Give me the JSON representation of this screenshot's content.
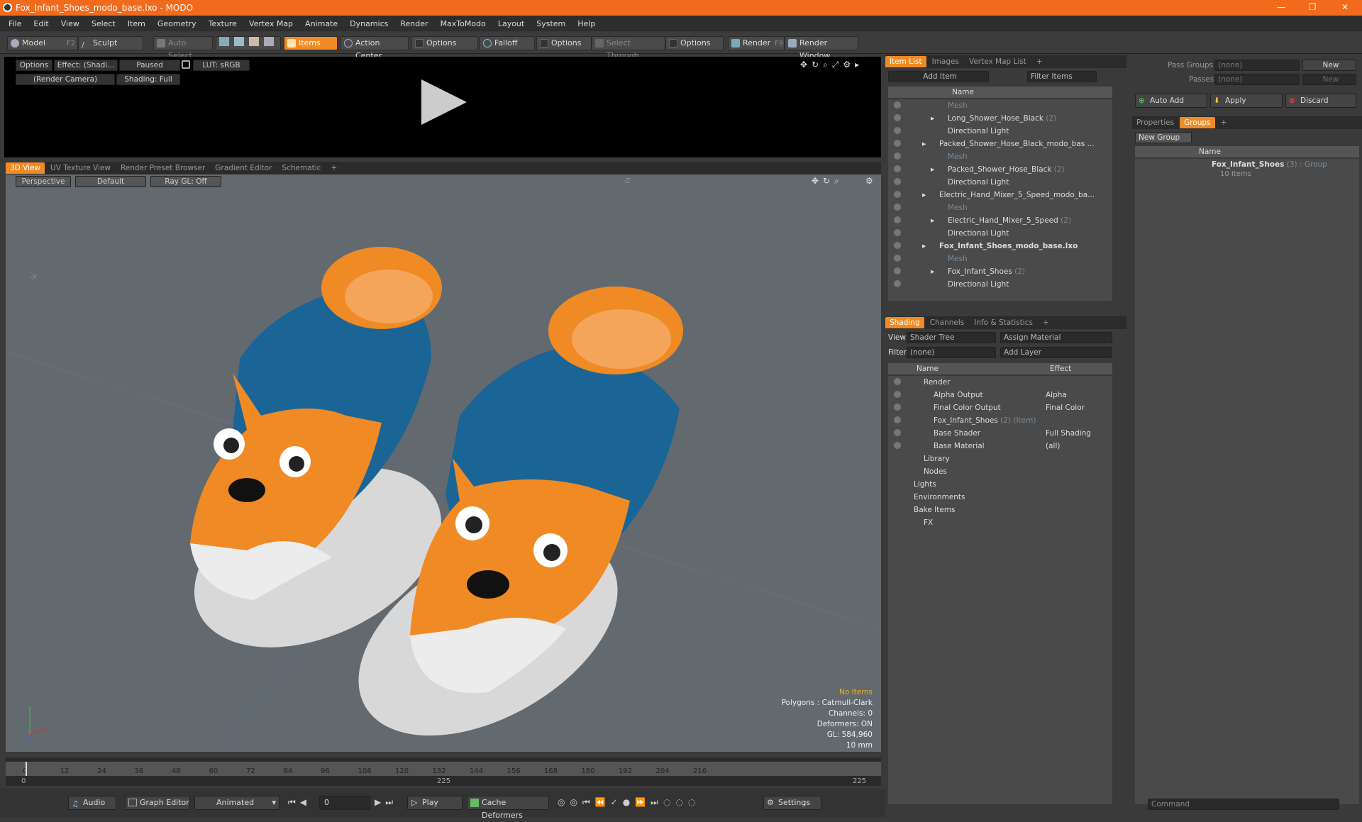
{
  "window": {
    "title": "Fox_Infant_Shoes_modo_base.lxo - MODO"
  },
  "menu": [
    "File",
    "Edit",
    "View",
    "Select",
    "Item",
    "Geometry",
    "Texture",
    "Vertex Map",
    "Animate",
    "Dynamics",
    "Render",
    "MaxToModo",
    "Layout",
    "System",
    "Help"
  ],
  "toolbar": {
    "model": "Model",
    "model_key": "F2",
    "sculpt": "Sculpt",
    "auto_select": "Auto Select",
    "items": "Items",
    "action_center": "Action Center",
    "options1": "Options",
    "falloff": "Falloff",
    "options2": "Options",
    "select_through": "Select Through",
    "options3": "Options",
    "render": "Render",
    "render_key": "F9",
    "render_window": "Render Window"
  },
  "preview": {
    "options": "Options",
    "effect": "Effect: (Shadi...",
    "paused": "Paused",
    "lut": "LUT: sRGB",
    "camera": "(Render Camera)",
    "shading": "Shading: Full"
  },
  "viewtabs": [
    "3D View",
    "UV Texture View",
    "Render Preset Browser",
    "Gradient Editor",
    "Schematic"
  ],
  "viewport": {
    "perspective": "Perspective",
    "default": "Default",
    "raygl": "Ray GL: Off",
    "axis_z": "-Z",
    "axis_x": "-X",
    "info": {
      "items": "No Items",
      "polygons": "Polygons : Catmull-Clark",
      "channels": "Channels: 0",
      "deformers": "Deformers: ON",
      "gl": "GL: 584,960",
      "unit": "10 mm"
    }
  },
  "timeline": {
    "ticks": [
      "0",
      "12",
      "24",
      "36",
      "48",
      "60",
      "72",
      "84",
      "96",
      "108",
      "120",
      "132",
      "144",
      "156",
      "168",
      "180",
      "192",
      "204",
      "216"
    ],
    "start": "0",
    "mid": "225",
    "end": "225"
  },
  "bottom": {
    "audio": "Audio",
    "graph": "Graph Editor",
    "animated": "Animated",
    "frame": "0",
    "play": "Play",
    "cache": "Cache Deformers",
    "settings": "Settings",
    "command": "Command"
  },
  "itemlist": {
    "tabs": [
      "Item List",
      "Images",
      "Vertex Map List"
    ],
    "add_item": "Add Item",
    "filter": "Filter Items",
    "col_name": "Name",
    "rows": [
      {
        "label": "Mesh",
        "dim": true,
        "indent": 2
      },
      {
        "label": "Long_Shower_Hose_Black",
        "count": "(2)",
        "indent": 2,
        "arrow": true
      },
      {
        "label": "Directional Light",
        "indent": 2
      },
      {
        "label": "Packed_Shower_Hose_Black_modo_bas ...",
        "indent": 1,
        "arrow": true
      },
      {
        "label": "Mesh",
        "dim": true,
        "indent": 2
      },
      {
        "label": "Packed_Shower_Hose_Black",
        "count": "(2)",
        "indent": 2,
        "arrow": true
      },
      {
        "label": "Directional Light",
        "indent": 2
      },
      {
        "label": "Electric_Hand_Mixer_5_Speed_modo_ba...",
        "indent": 1,
        "arrow": true
      },
      {
        "label": "Mesh",
        "dim": true,
        "indent": 2
      },
      {
        "label": "Electric_Hand_Mixer_5_Speed",
        "count": "(2)",
        "indent": 2,
        "arrow": true
      },
      {
        "label": "Directional Light",
        "indent": 2
      },
      {
        "label": "Fox_Infant_Shoes_modo_base.lxo",
        "indent": 1,
        "arrow": true,
        "bold": true
      },
      {
        "label": "Mesh",
        "dim": true,
        "indent": 2
      },
      {
        "label": "Fox_Infant_Shoes",
        "count": "(2)",
        "indent": 2,
        "arrow": true
      },
      {
        "label": "Directional Light",
        "indent": 2
      }
    ]
  },
  "shading": {
    "tabs": [
      "Shading",
      "Channels",
      "Info & Statistics"
    ],
    "view_label": "View",
    "view": "Shader Tree",
    "assign": "Assign Material",
    "filter_label": "Filter",
    "filter": "(none)",
    "add_layer": "Add Layer",
    "col_name": "Name",
    "col_effect": "Effect",
    "rows": [
      {
        "label": "Render",
        "effect": "",
        "indent": 0
      },
      {
        "label": "Alpha Output",
        "effect": "Alpha",
        "indent": 1
      },
      {
        "label": "Final Color Output",
        "effect": "Final Color",
        "indent": 1
      },
      {
        "label": "Fox_Infant_Shoes",
        "count": "(2) (Item)",
        "effect": "",
        "indent": 1
      },
      {
        "label": "Base Shader",
        "effect": "Full Shading",
        "indent": 1
      },
      {
        "label": "Base Material",
        "effect": "(all)",
        "indent": 1
      },
      {
        "label": "Library",
        "effect": "",
        "indent": 0
      },
      {
        "label": "Nodes",
        "effect": "",
        "indent": 0
      },
      {
        "label": "Lights",
        "effect": "",
        "indent": -1
      },
      {
        "label": "Environments",
        "effect": "",
        "indent": -1
      },
      {
        "label": "Bake Items",
        "effect": "",
        "indent": -1
      },
      {
        "label": "FX",
        "effect": "",
        "indent": 0
      }
    ]
  },
  "right": {
    "pass_groups": "Pass Groups",
    "passes": "Passes",
    "none": "(none)",
    "new": "New",
    "auto_add": "Auto Add",
    "apply": "Apply",
    "discard": "Discard",
    "tabs": [
      "Properties",
      "Groups"
    ],
    "new_group": "New Group",
    "col_name": "Name",
    "group_name": "Fox_Infant_Shoes",
    "group_count": "(3)",
    "group_type": ": Group",
    "group_items": "10 Items"
  }
}
